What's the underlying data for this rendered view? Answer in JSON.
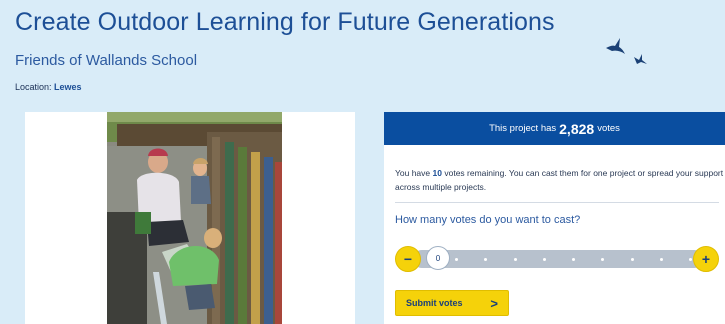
{
  "project": {
    "title": "Create Outdoor Learning for Future Generations",
    "organisation": "Friends of Wallands School",
    "location_label": "Location:",
    "location": "Lewes"
  },
  "icons": [
    "bird-icon",
    "bird-icon",
    "minus-icon",
    "plus-icon",
    "chevron-right-icon"
  ],
  "votes": {
    "header_prefix": "This project has",
    "total": "2,828",
    "header_suffix": "votes",
    "remaining_prefix": "You have",
    "remaining_count": "10",
    "remaining_suffix": "votes remaining. You can cast them for one project or spread your support across multiple projects.",
    "question": "How many votes do you want to cast?",
    "minus_label": "−",
    "plus_label": "+",
    "selected_value": "0",
    "slider_max": 10,
    "submit_label": "Submit votes",
    "submit_arrow": ">"
  },
  "colors": {
    "brand_blue": "#0a4ea0",
    "accent_yellow": "#f5d20a",
    "page_bg": "#d9ecf8"
  }
}
